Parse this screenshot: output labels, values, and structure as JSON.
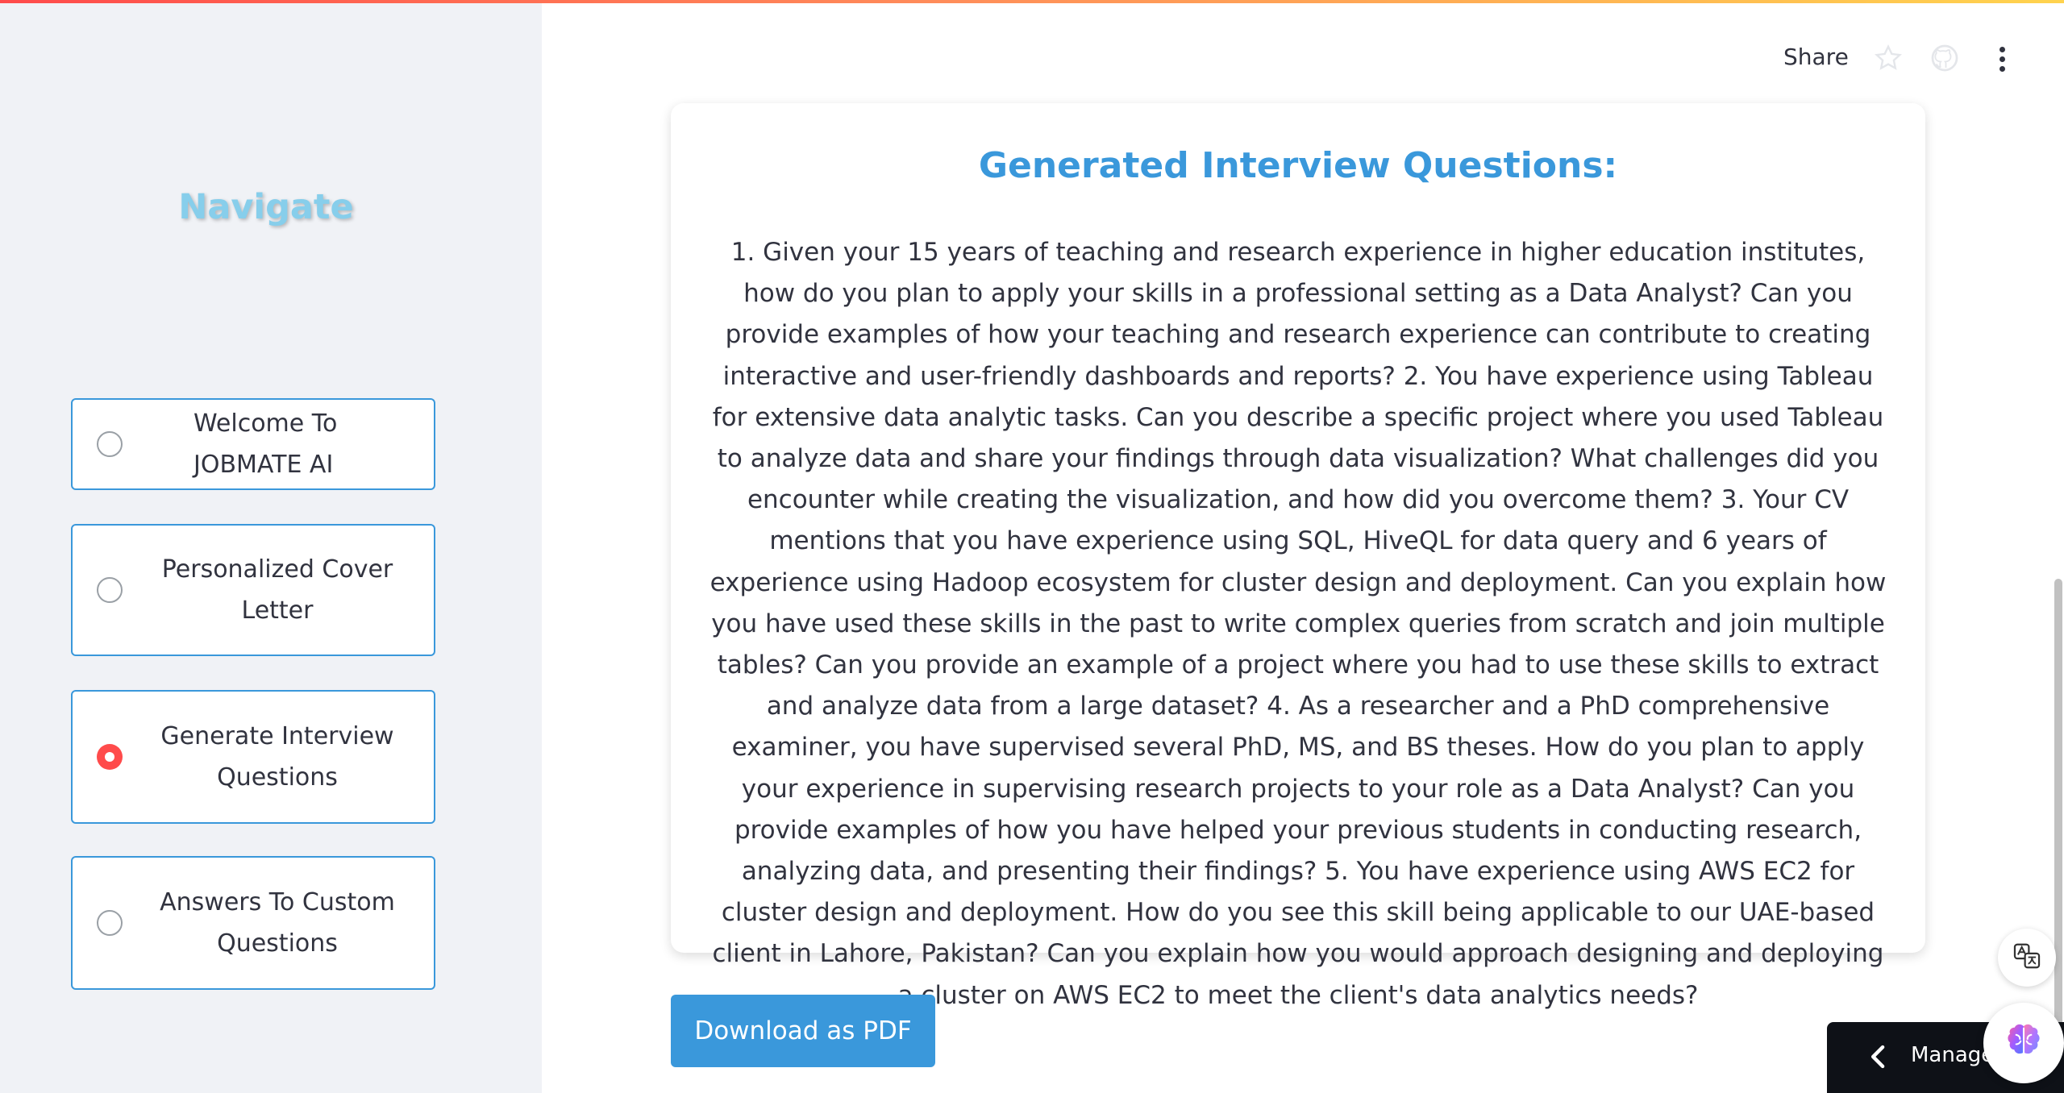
{
  "sidebar": {
    "title": "Navigate",
    "options": [
      {
        "label": "Welcome To JOBMATE AI",
        "selected": false
      },
      {
        "label": "Personalized Cover Letter",
        "selected": false
      },
      {
        "label": "Generate Interview Questions",
        "selected": true
      },
      {
        "label": "Answers To Custom Questions",
        "selected": false
      }
    ]
  },
  "header": {
    "share_label": "Share",
    "icons": [
      "star-icon",
      "github-icon",
      "more-vertical-icon"
    ]
  },
  "main": {
    "card_title": "Generated Interview Questions:",
    "card_body": "1. Given your 15 years of teaching and research experience in higher education institutes, how do you plan to apply your skills in a professional setting as a Data Analyst? Can you provide examples of how your teaching and research experience can contribute to creating interactive and user-friendly dashboards and reports? 2. You have experience using Tableau for extensive data analytic tasks. Can you describe a specific project where you used Tableau to analyze data and share your findings through data visualization? What challenges did you encounter while creating the visualization, and how did you overcome them? 3. Your CV mentions that you have experience using SQL, HiveQL for data query and 6 years of experience using Hadoop ecosystem for cluster design and deployment. Can you explain how you have used these skills in the past to write complex queries from scratch and join multiple tables? Can you provide an example of a project where you had to use these skills to extract and analyze data from a large dataset? 4. As a researcher and a PhD comprehensive examiner, you have supervised several PhD, MS, and BS theses. How do you plan to apply your experience in supervising research projects to your role as a Data Analyst? Can you provide examples of how you have helped your previous students in conducting research, analyzing data, and presenting their findings? 5. You have experience using AWS EC2 for cluster design and deployment. How do you see this skill being applicable to our UAE-based client in Lahore, Pakistan? Can you explain how you would approach designing and deploying a cluster on AWS EC2 to meet the client's data analytics needs?",
    "download_label": "Download as PDF"
  },
  "footer": {
    "manage_label": "Manage app"
  },
  "colors": {
    "accent_blue": "#3a98db",
    "nav_title": "#87ceeb",
    "radio_selected": "#ff4b4b",
    "sidebar_bg": "#f0f2f6"
  }
}
